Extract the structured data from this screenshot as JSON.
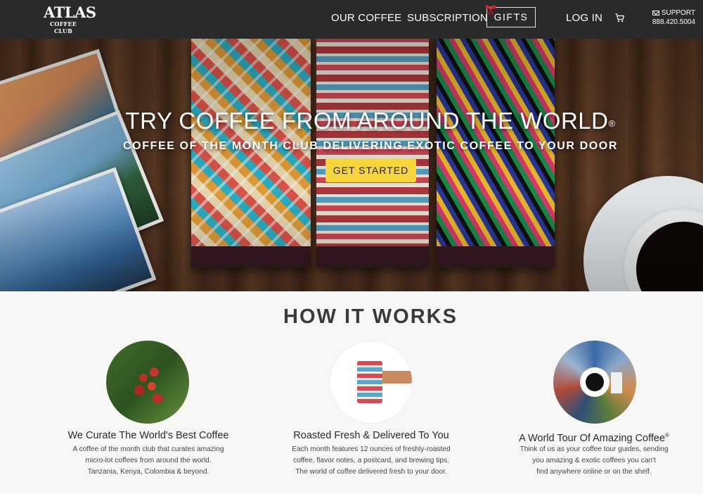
{
  "header": {
    "logo_main": "ATLAS",
    "logo_sub": "COFFEE CLUB",
    "nav": {
      "our_coffee": "OUR COFFEE",
      "subscription": "SUBSCRIPTION",
      "gifts": "GIFTS",
      "login": "LOG IN"
    },
    "support_label": "SUPPORT",
    "support_phone": "888.420.5004",
    "cart_icon": "cart-icon",
    "mail_icon": "mail-icon",
    "bow_icon": "bow-icon"
  },
  "hero": {
    "title": "TRY COFFEE FROM AROUND THE WORLD",
    "title_mark": "®",
    "subtitle": "COFFEE OF THE MONTH CLUB DELIVERING EXOTIC COFFEE TO YOUR DOOR",
    "cta": "GET STARTED"
  },
  "how_it_works": {
    "title": "HOW IT WORKS",
    "columns": [
      {
        "title": "We Curate The World's Best Coffee",
        "lines": [
          "A coffee of the month club that curates amazing",
          "micro-lot coffees from around the world.",
          "Tanzania, Kenya, Colombia & beyond."
        ]
      },
      {
        "title": "Roasted Fresh & Delivered To You",
        "lines": [
          "Each month features 12 ounces of freshly-roasted",
          "coffee, flavor notes, a postcard, and brewing tips.",
          "The world of coffee delivered fresh to your door."
        ]
      },
      {
        "title": "A World Tour Of Amazing Coffee",
        "title_mark": "®",
        "lines": [
          "Think of us as your coffee tour guides, sending",
          "you amazing & exotic coffees you can't",
          "find anywhere online or on the shelf."
        ]
      }
    ]
  },
  "colors": {
    "header_bg": "#2a2a2a",
    "cta_bg": "#f7d53d",
    "page_bg": "#f7f7f5"
  }
}
